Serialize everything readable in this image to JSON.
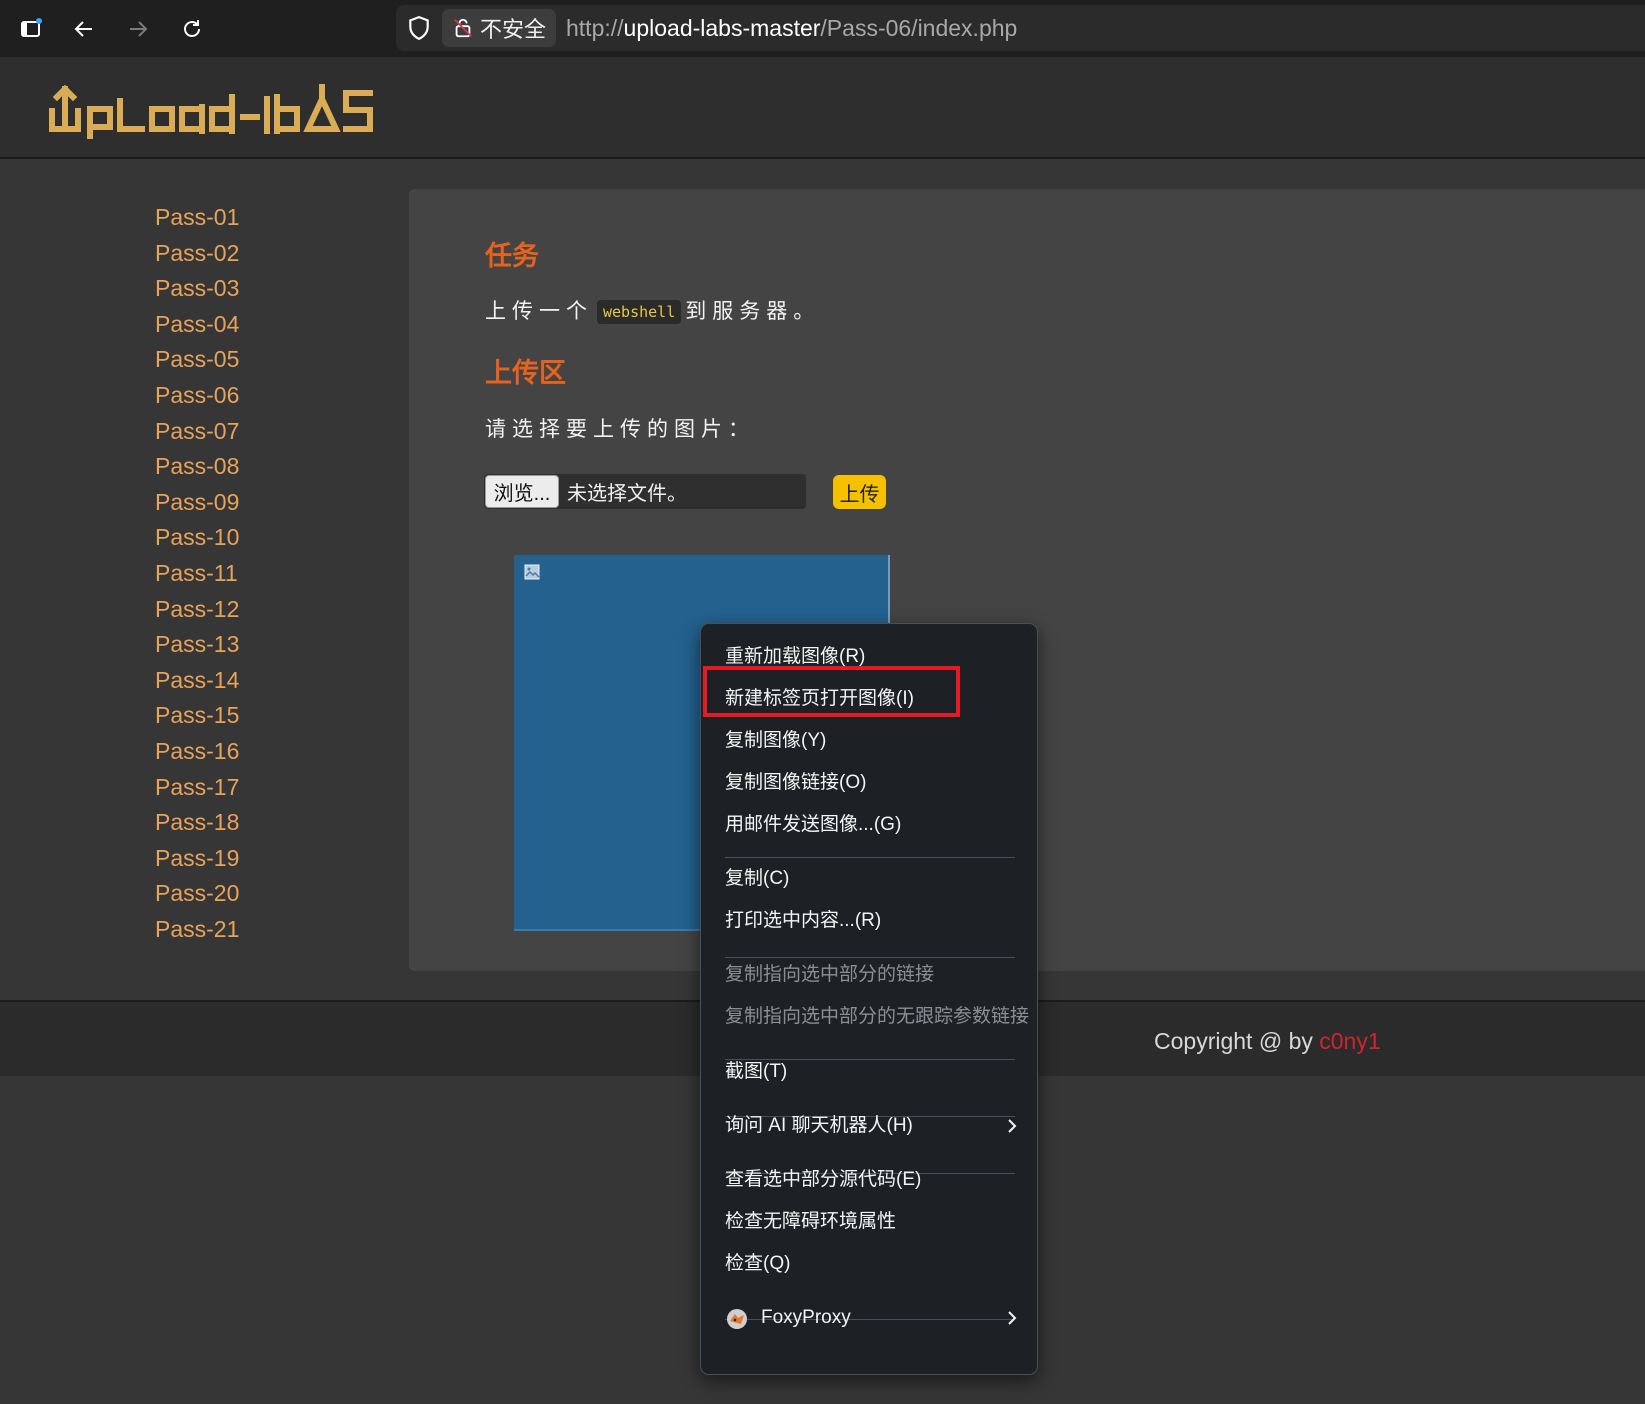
{
  "browser": {
    "insecure_label": "不安全",
    "url_scheme": "http://",
    "url_host": "upload-labs-master",
    "url_path": "/Pass-06/index.php"
  },
  "site": {
    "logo_text": "UpLoad-labs"
  },
  "sidebar": {
    "items": [
      "Pass-01",
      "Pass-02",
      "Pass-03",
      "Pass-04",
      "Pass-05",
      "Pass-06",
      "Pass-07",
      "Pass-08",
      "Pass-09",
      "Pass-10",
      "Pass-11",
      "Pass-12",
      "Pass-13",
      "Pass-14",
      "Pass-15",
      "Pass-16",
      "Pass-17",
      "Pass-18",
      "Pass-19",
      "Pass-20",
      "Pass-21"
    ]
  },
  "main": {
    "task_title": "任务",
    "task_text_before": "上传一个",
    "task_code": "webshell",
    "task_text_after": "到服务器。",
    "upload_title": "上传区",
    "select_prompt": "请选择要上传的图片：",
    "browse_label": "浏览...",
    "no_file_label": "未选择文件。",
    "upload_button": "上传"
  },
  "footer": {
    "copyright_prefix": "Copyright @  by ",
    "author": "c0ny1"
  },
  "context_menu": {
    "items": {
      "reload_image": "重新加载图像(R)",
      "open_image_new_tab": "新建标签页打开图像(I)",
      "copy_image": "复制图像(Y)",
      "copy_image_link": "复制图像链接(O)",
      "email_image": "用邮件发送图像...(G)",
      "copy": "复制(C)",
      "print_selection": "打印选中内容...(R)",
      "copy_link_to_highlight": "复制指向选中部分的链接",
      "copy_clean_link_to_highlight": "复制指向选中部分的无跟踪参数链接",
      "screenshot": "截图(T)",
      "ask_ai_chatbot": "询问 AI 聊天机器人(H)",
      "view_selection_source": "查看选中部分源代码(E)",
      "inspect_accessibility": "检查无障碍环境属性",
      "inspect": "检查(Q)",
      "foxyproxy": "FoxyProxy"
    }
  },
  "colors": {
    "accent_orange": "#e5631e",
    "link_orange": "#e8a35a",
    "upload_yellow": "#f5c000",
    "highlight_red": "#e41b24",
    "author_red": "#d0242e"
  }
}
